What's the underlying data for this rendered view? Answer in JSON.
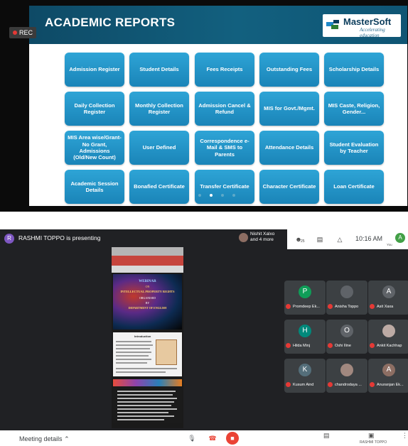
{
  "slide": {
    "title": "ACADEMIC REPORTS",
    "rec_label": "REC",
    "logo_text": "MasterSoft",
    "logo_tagline": "Accelerating education",
    "tiles": [
      "Admission Register",
      "Student Details",
      "Fees Receipts",
      "Outstanding Fees",
      "Scholarship Details",
      "Daily Collection Register",
      "Monthly Collection Register",
      "Admission Cancel & Refund",
      "MIS for Govt./Mgmt.",
      "MIS Caste, Religion, Gender...",
      "MIS Area wise/Grant-No Grant, Admissions (Old/New Count)",
      "User Defined",
      "Correspondence e-Mail & SMS to Parents",
      "Attendance Details",
      "Student Evaluation by Teacher",
      "Academic Session Details",
      "Bonafied Certificate",
      "Transfer Certificate",
      "Character Certificate",
      "Loan Certificate"
    ]
  },
  "meet": {
    "presenter_initial": "R",
    "presenting_text": "RASHMI TOPPO is presenting",
    "pinned_line1": "Nishit Xalxo",
    "pinned_line2": "and 4 more",
    "participants_count": "25",
    "time": "10:16 AM",
    "you_initial": "A",
    "you_label": "You",
    "doc": {
      "poster_line1": "WEBINAR",
      "poster_line2": "ON",
      "poster_line3": "INTELLECTUAL PROPERTY RIGHTS",
      "poster_line4": "ORGANISED",
      "poster_line5": "BY",
      "poster_line6": "DEPARTMENT OF ENGLISH",
      "intro_title": "Introduction"
    },
    "participants": [
      {
        "initial": "P",
        "name": "Promdeep Ek...",
        "color": "#0f9d58"
      },
      {
        "initial": "",
        "name": "Anisha Toppo",
        "color": "#5f6368"
      },
      {
        "initial": "A",
        "name": "Asit Xaxa",
        "color": "#5f6368"
      },
      {
        "initial": "H",
        "name": "Hilda Minj",
        "color": "#00897b"
      },
      {
        "initial": "O",
        "name": "Oshi Iline",
        "color": "#5f6368"
      },
      {
        "initial": "",
        "name": "Ankit Kachhap",
        "color": "#bcaaa4"
      },
      {
        "initial": "K",
        "name": "Kusum Aind",
        "color": "#546e7a"
      },
      {
        "initial": "",
        "name": "chandrodaya ...",
        "color": "#a1887f"
      },
      {
        "initial": "A",
        "name": "Anuranjan Ek...",
        "color": "#8d6e63"
      }
    ],
    "meeting_details": "Meeting details",
    "presenter_label": "RASHMI TOPPO"
  },
  "colors": {
    "slide_header": "#0e4a66",
    "tile": "#1a84b8",
    "meet_bg": "#202124",
    "end_call": "#ea4335"
  }
}
